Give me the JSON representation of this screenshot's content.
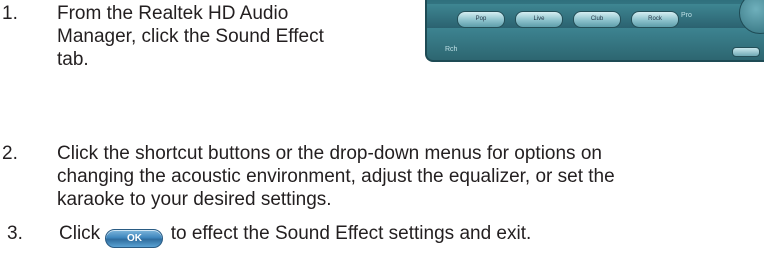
{
  "steps": [
    {
      "number": "1.",
      "lines": [
        "From the Realtek HD Audio",
        "Manager, click the Sound Effect",
        "tab."
      ]
    },
    {
      "number": "2.",
      "lines": [
        "Click the shortcut buttons or the drop-down menus for options on",
        "changing the acoustic environment, adjust the equalizer, or set the",
        "karaoke to your desired settings."
      ]
    },
    {
      "number": "3.",
      "before": "Click",
      "button_label": "OK",
      "after": "to effect the Sound Effect settings and exit."
    }
  ],
  "screenshot": {
    "buttons": [
      "Pop",
      "Live",
      "Club",
      "Rock"
    ],
    "side_label": "Pro",
    "corner_label": "Rch"
  }
}
